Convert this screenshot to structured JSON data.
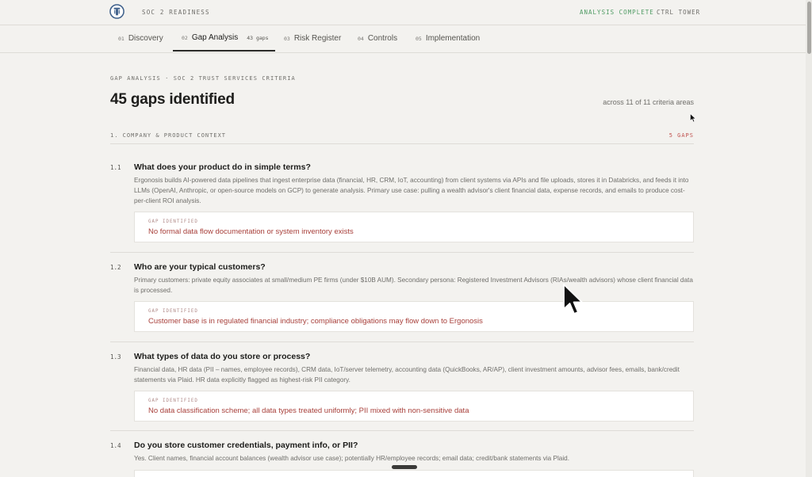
{
  "topbar": {
    "title": "SOC 2 READINESS",
    "status": "ANALYSIS COMPLETE",
    "user": "CTRL TOWER",
    "logo_icon": "shield-logo-icon"
  },
  "tabs": [
    {
      "num": "01",
      "label": "Discovery"
    },
    {
      "num": "02",
      "label": "Gap Analysis",
      "badge": "43 gaps",
      "active": true
    },
    {
      "num": "03",
      "label": "Risk Register"
    },
    {
      "num": "04",
      "label": "Controls"
    },
    {
      "num": "05",
      "label": "Implementation"
    }
  ],
  "header": {
    "eyebrow": "GAP ANALYSIS · SOC 2 TRUST SERVICES CRITERIA",
    "headline": "45 gaps identified",
    "areas": "across 11 of 11 criteria areas"
  },
  "section": {
    "label": "1. COMPANY & PRODUCT CONTEXT",
    "count": "5 GAPS"
  },
  "gap_label": "GAP IDENTIFIED",
  "questions": [
    {
      "num": "1.1",
      "title": "What does your product do in simple terms?",
      "answer": "Ergonosis builds AI-powered data pipelines that ingest enterprise data (financial, HR, CRM, IoT, accounting) from client systems via APIs and file uploads, stores it in Databricks, and feeds it into LLMs (OpenAI, Anthropic, or open-source models on GCP) to generate analysis. Primary use case: pulling a wealth advisor's client financial data, expense records, and emails to produce cost-per-client ROI analysis.",
      "gap": "No formal data flow documentation or system inventory exists"
    },
    {
      "num": "1.2",
      "title": "Who are your typical customers?",
      "answer": "Primary customers: private equity associates at small/medium PE firms (under $10B AUM). Secondary persona: Registered Investment Advisors (RIAs/wealth advisors) whose client financial data is processed.",
      "gap": "Customer base is in regulated financial industry; compliance obligations may flow down to Ergonosis"
    },
    {
      "num": "1.3",
      "title": "What types of data do you store or process?",
      "answer": "Financial data, HR data (PII – names, employee records), CRM data, IoT/server telemetry, accounting data (QuickBooks, AR/AP), client investment amounts, advisor fees, emails, bank/credit statements via Plaid. HR data explicitly flagged as highest-risk PII category.",
      "gap": "No data classification scheme; all data types treated uniformly; PII mixed with non-sensitive data"
    },
    {
      "num": "1.4",
      "title": "Do you store customer credentials, payment info, or PII?",
      "answer": "Yes. Client names, financial account balances (wealth advisor use case); potentially HR/employee records; email data; credit/bank statements via Plaid."
    }
  ]
}
